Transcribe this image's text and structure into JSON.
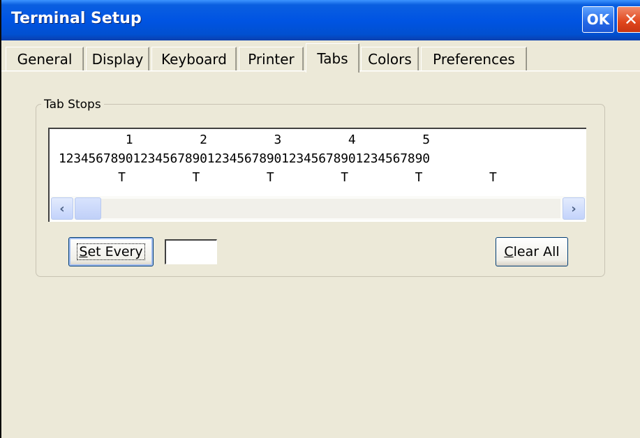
{
  "window": {
    "title": "Terminal Setup",
    "ok_label": "OK",
    "close_label": "✕"
  },
  "tabs": [
    {
      "label": "General",
      "active": false
    },
    {
      "label": "Display",
      "active": false
    },
    {
      "label": "Keyboard",
      "active": false
    },
    {
      "label": "Printer",
      "active": false
    },
    {
      "label": "Tabs",
      "active": true
    },
    {
      "label": "Colors",
      "active": false
    },
    {
      "label": "Preferences",
      "active": false
    }
  ],
  "tab_stops": {
    "group_label": "Tab Stops",
    "ruler": {
      "tens_row": "         1         2         3         4         5",
      "digits_row": "12345678901234567890123456789012345678901234567890",
      "stops_row": "        T         T         T         T         T         T"
    },
    "scroll_left": "‹",
    "scroll_right": "›",
    "set_every_prefix": "S",
    "set_every_rest": "et Every",
    "set_every_value": "",
    "clear_all_prefix": "C",
    "clear_all_rest": "lear All"
  },
  "colors": {
    "titlebar": "#0054e3",
    "window_bg": "#ece9d8",
    "close_button": "#e0461c"
  }
}
